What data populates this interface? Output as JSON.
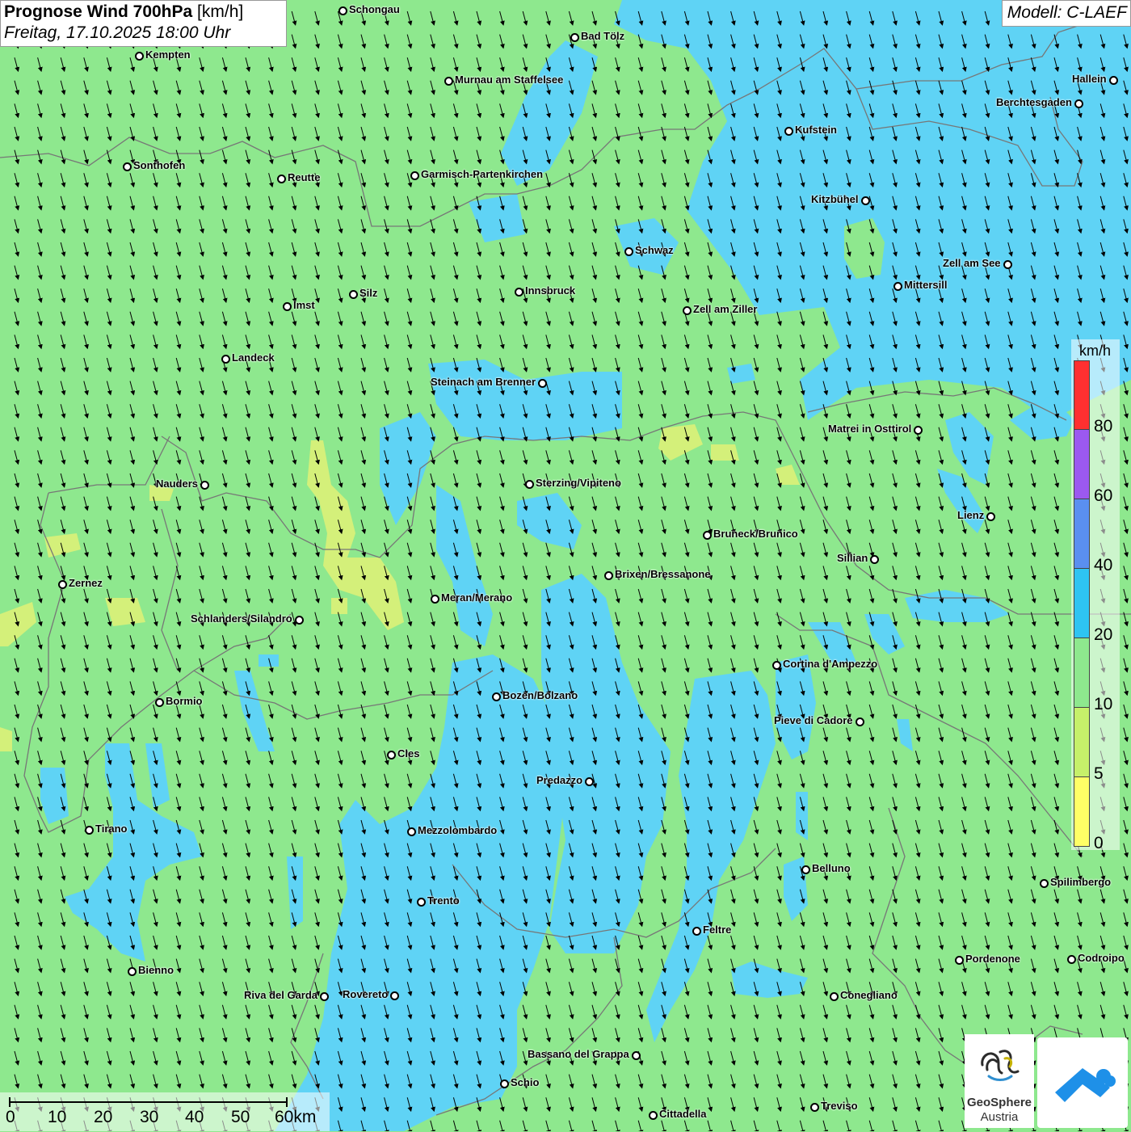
{
  "title": {
    "main": "Prognose Wind 700hPa",
    "unit": "[km/h]",
    "datetime": "Freitag, 17.10.2025 18:00 Uhr"
  },
  "model_label": "Modell: C-LAEF",
  "legend": {
    "unit": "km/h",
    "colors": [
      "#ff3030",
      "#9b59f0",
      "#5a8ff0",
      "#2ec4f2",
      "#8ee88e",
      "#c6f06a",
      "#ffff66"
    ],
    "labels": [
      "80",
      "60",
      "40",
      "20",
      "10",
      "5",
      "0"
    ]
  },
  "scale_bar": {
    "labels": [
      "0",
      "10",
      "20",
      "30",
      "40",
      "50",
      "60km"
    ]
  },
  "wind_direction": "north-north-west (arrows pointing south-south-east)",
  "cities": [
    {
      "name": "Schongau"
    },
    {
      "name": "Kempten"
    },
    {
      "name": "Bad Tölz"
    },
    {
      "name": "Murnau am Staffelsee"
    },
    {
      "name": "Hallein"
    },
    {
      "name": "Berchtesgaden"
    },
    {
      "name": "Kufstein"
    },
    {
      "name": "Sonthofen"
    },
    {
      "name": "Reutte"
    },
    {
      "name": "Garmisch-Partenkirchen"
    },
    {
      "name": "Kitzbühel"
    },
    {
      "name": "Schwaz"
    },
    {
      "name": "Zell am See"
    },
    {
      "name": "Innsbruck"
    },
    {
      "name": "Mittersill"
    },
    {
      "name": "Silz"
    },
    {
      "name": "Imst"
    },
    {
      "name": "Zell am Ziller"
    },
    {
      "name": "Landeck"
    },
    {
      "name": "Steinach am Brenner"
    },
    {
      "name": "Matrei in Osttirol"
    },
    {
      "name": "Nauders"
    },
    {
      "name": "Sterzing/Vipiteno"
    },
    {
      "name": "Lienz"
    },
    {
      "name": "Bruneck/Brunico"
    },
    {
      "name": "Sillian"
    },
    {
      "name": "Zernez"
    },
    {
      "name": "Brixen/Bressanone"
    },
    {
      "name": "Meran/Merano"
    },
    {
      "name": "Schlanders/Silandro"
    },
    {
      "name": "Cortina d'Ampezzo"
    },
    {
      "name": "Bozen/Bolzano"
    },
    {
      "name": "Bormio"
    },
    {
      "name": "Pieve di Cadore"
    },
    {
      "name": "Cles"
    },
    {
      "name": "Predazzo"
    },
    {
      "name": "Tirano"
    },
    {
      "name": "Mezzolombardo"
    },
    {
      "name": "Belluno"
    },
    {
      "name": "Spilimbergo"
    },
    {
      "name": "Trento"
    },
    {
      "name": "Feltre"
    },
    {
      "name": "Bienno"
    },
    {
      "name": "Pordenone"
    },
    {
      "name": "Codroipo"
    },
    {
      "name": "Riva del Garda"
    },
    {
      "name": "Rovereto"
    },
    {
      "name": "Conegliano"
    },
    {
      "name": "Bassano del Grappa"
    },
    {
      "name": "Schio"
    },
    {
      "name": "Treviso"
    },
    {
      "name": "Cittadella"
    }
  ],
  "logos": {
    "geosphere_line1": "GeoSphere",
    "geosphere_line2": "Austria"
  }
}
